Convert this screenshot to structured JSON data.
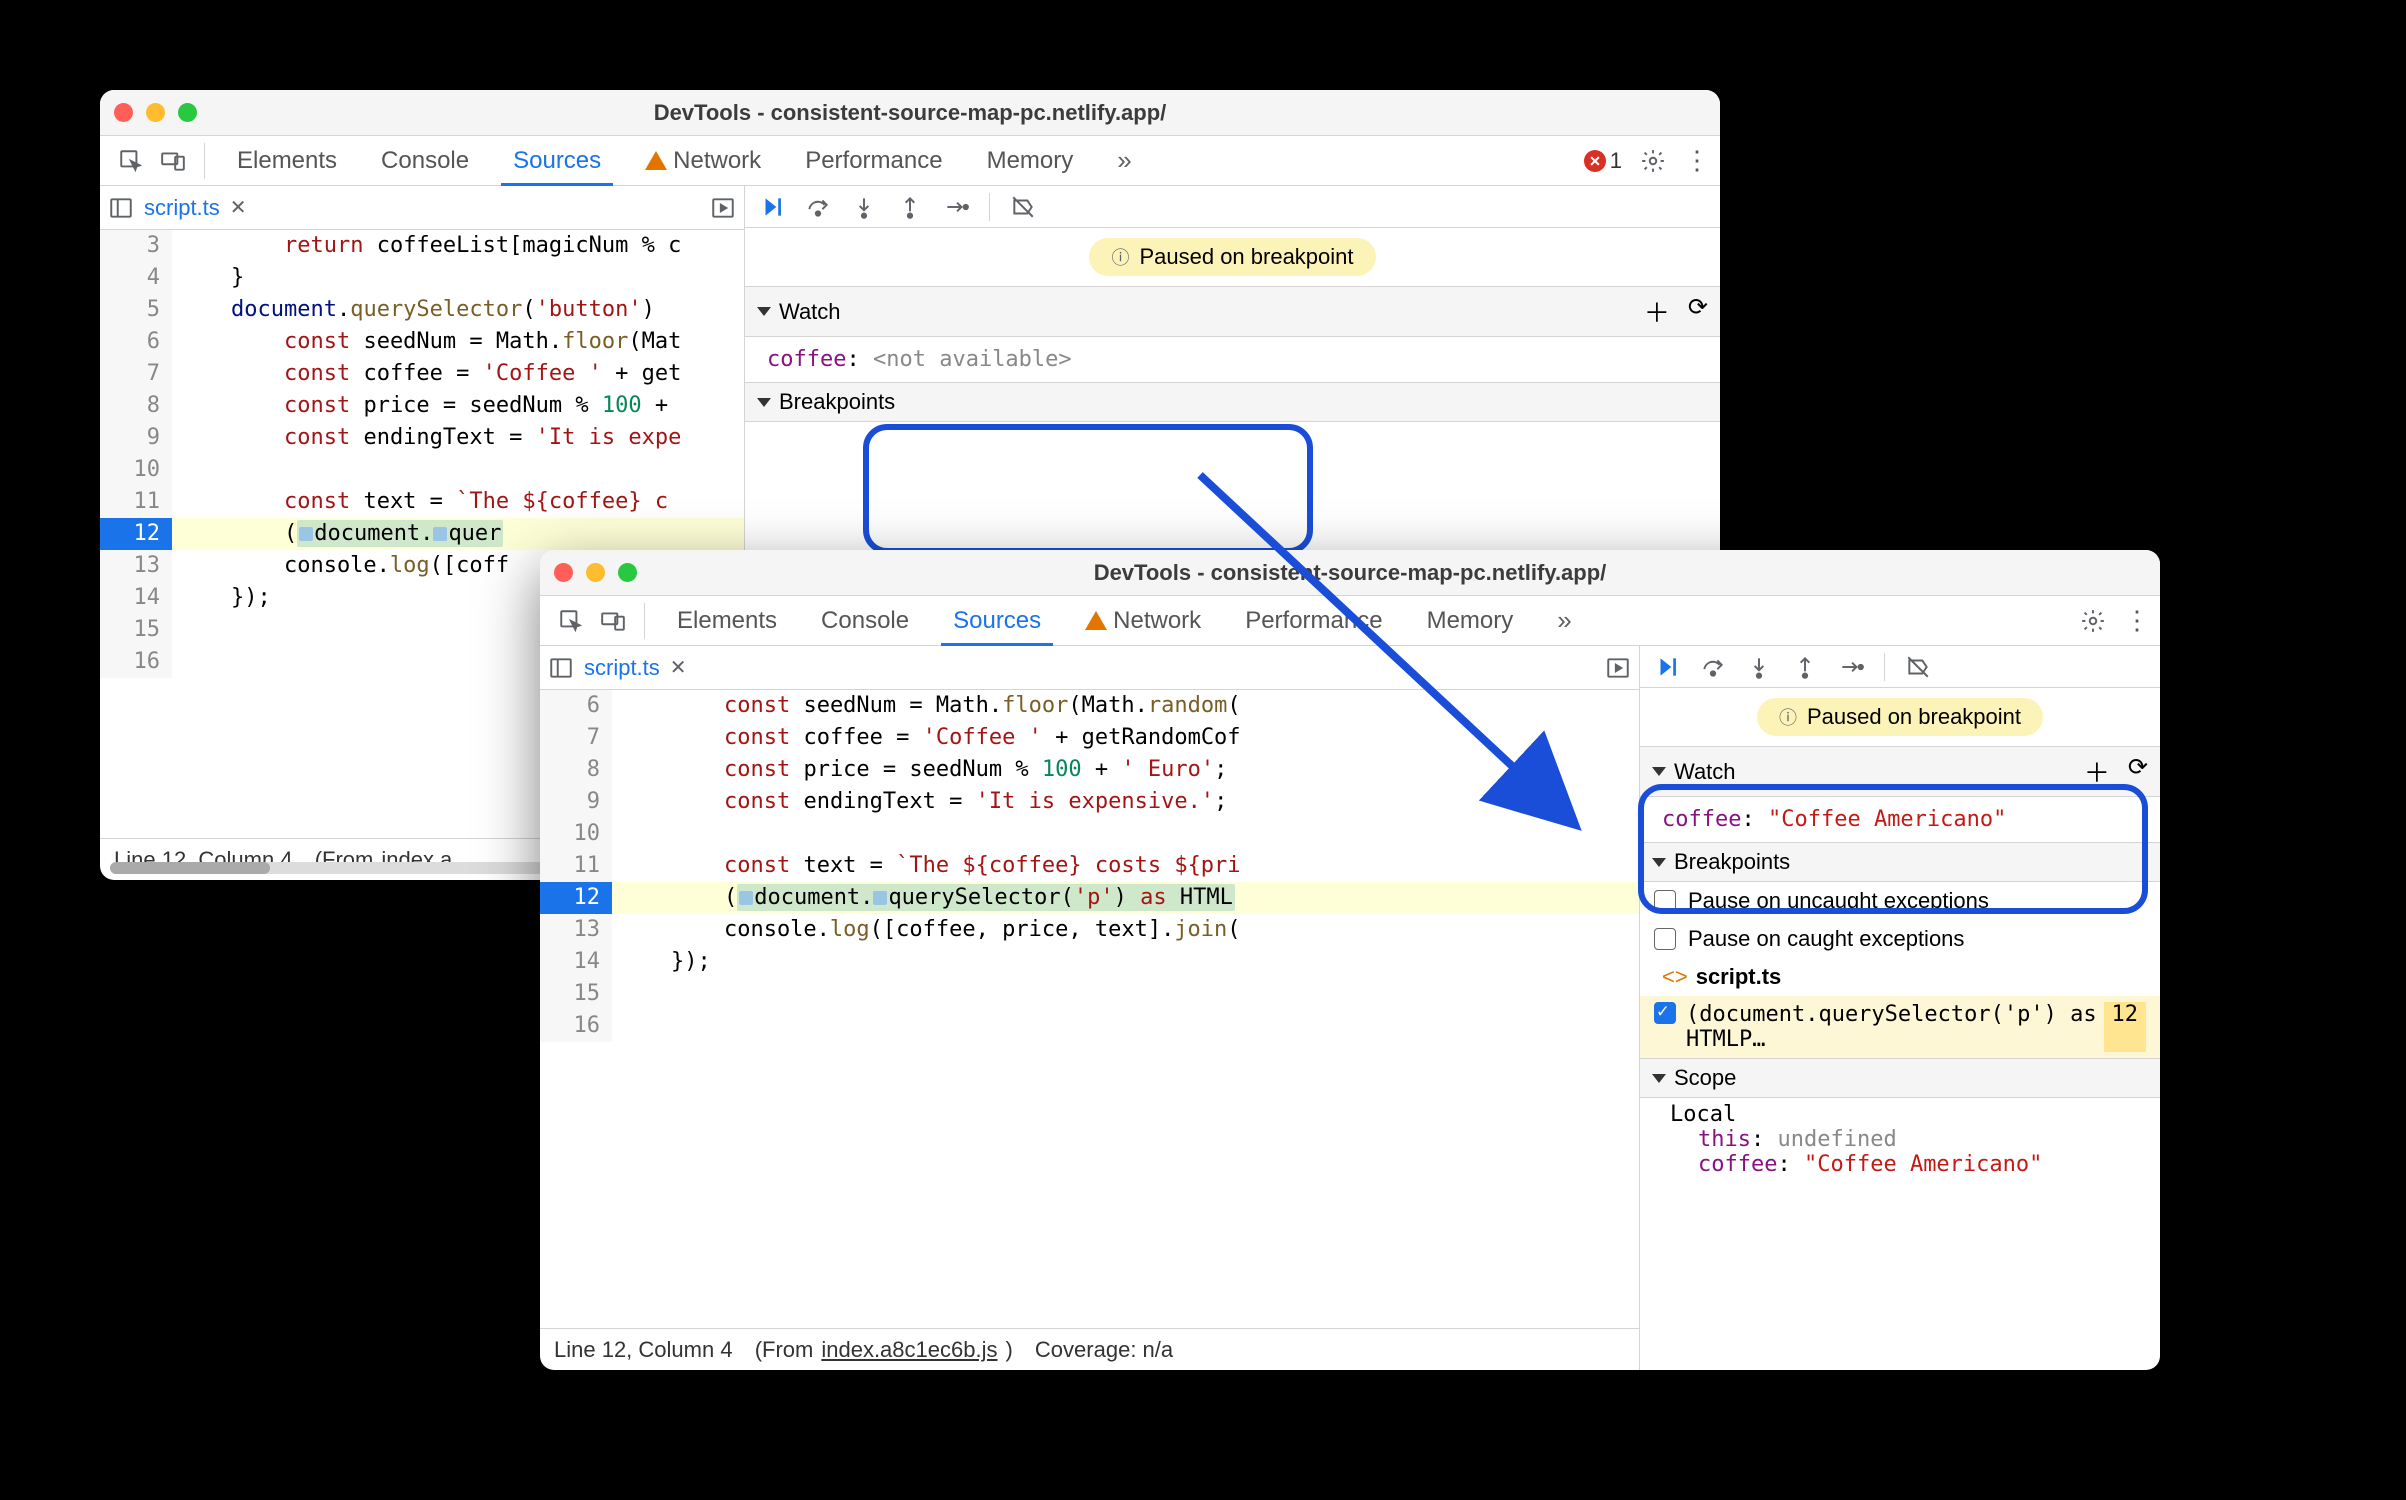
{
  "title": "DevTools - consistent-source-map-pc.netlify.app/",
  "tabs": {
    "elements": "Elements",
    "console": "Console",
    "sources": "Sources",
    "network": "Network",
    "performance": "Performance",
    "memory": "Memory"
  },
  "error_count": "1",
  "file_tab": "script.ts",
  "paused_text": "Paused on breakpoint",
  "watch": {
    "title": "Watch",
    "key": "coffee",
    "val_a": "<not available>",
    "val_b": "\"Coffee Americano\""
  },
  "breakpoints": {
    "title": "Breakpoints",
    "uncaught": "Pause on uncaught exceptions",
    "caught": "Pause on caught exceptions",
    "file": "script.ts",
    "expr": "(document.querySelector('p') as HTMLP…",
    "line": "12"
  },
  "scope": {
    "title": "Scope",
    "local": "Local",
    "this_key": "this",
    "this_val": "undefined",
    "coffee_key": "coffee",
    "coffee_val": "\"Coffee Americano\""
  },
  "status_a": {
    "pos": "Line 12, Column 4",
    "from": "(From ",
    "file": "index.a…"
  },
  "status_b": {
    "pos": "Line 12, Column 4",
    "from": "(From ",
    "file": "index.a8c1ec6b.js",
    "close": ")",
    "coverage": "Coverage: n/a"
  },
  "code_a": [
    {
      "n": "3",
      "html": "        <span class='tok-kw'>return</span> coffeeList[magicNum % c"
    },
    {
      "n": "4",
      "html": "    }"
    },
    {
      "n": "5",
      "html": "    <span class='tok-prop'>document</span>.<span class='tok-fn'>querySelector</span>(<span class='tok-str'>'button'</span>)"
    },
    {
      "n": "6",
      "html": "        <span class='tok-kw'>const</span> seedNum = Math.<span class='tok-fn'>floor</span>(Mat"
    },
    {
      "n": "7",
      "html": "        <span class='tok-kw'>const</span> coffee = <span class='tok-str'>'Coffee '</span> + get"
    },
    {
      "n": "8",
      "html": "        <span class='tok-kw'>const</span> price = seedNum % <span class='tok-num'>100</span> + "
    },
    {
      "n": "9",
      "html": "        <span class='tok-kw'>const</span> endingText = <span class='tok-str'>'It is expe"
    },
    {
      "n": "10",
      "html": ""
    },
    {
      "n": "11",
      "html": "        <span class='tok-kw'>const</span> text = <span class='tok-str'>`The ${coffee} c</span>"
    },
    {
      "n": "12",
      "html": "        (<span class='hl-box'><span class='dot-mark'></span>document.<span class='dot-mark'></span>quer</span>",
      "bp": true
    },
    {
      "n": "13",
      "html": "        console.<span class='tok-fn'>log</span>([coff"
    },
    {
      "n": "14",
      "html": "    });"
    },
    {
      "n": "15",
      "html": ""
    },
    {
      "n": "16",
      "html": ""
    }
  ],
  "code_b": [
    {
      "n": "6",
      "html": "        <span class='tok-kw'>const</span> seedNum = Math.<span class='tok-fn'>floor</span>(Math.<span class='tok-fn'>random</span>("
    },
    {
      "n": "7",
      "html": "        <span class='tok-kw'>const</span> coffee = <span class='tok-str'>'Coffee '</span> + getRandomCof"
    },
    {
      "n": "8",
      "html": "        <span class='tok-kw'>const</span> price = seedNum % <span class='tok-num'>100</span> + <span class='tok-str'>' Euro'</span>;"
    },
    {
      "n": "9",
      "html": "        <span class='tok-kw'>const</span> endingText = <span class='tok-str'>'It is expensive.'</span>;"
    },
    {
      "n": "10",
      "html": ""
    },
    {
      "n": "11",
      "html": "        <span class='tok-kw'>const</span> text = <span class='tok-str'>`The ${coffee} costs ${pri</span>"
    },
    {
      "n": "12",
      "html": "        (<span class='hl-box'><span class='dot-mark'></span>document.<span class='dot-mark'></span>querySelector(<span class='tok-str'>'p'</span>) <span class='tok-kw'>as</span> HTML</span>",
      "bp": true
    },
    {
      "n": "13",
      "html": "        console.<span class='tok-fn'>log</span>([coffee, price, text].<span class='tok-fn'>join</span>("
    },
    {
      "n": "14",
      "html": "    });"
    },
    {
      "n": "15",
      "html": ""
    },
    {
      "n": "16",
      "html": ""
    }
  ]
}
